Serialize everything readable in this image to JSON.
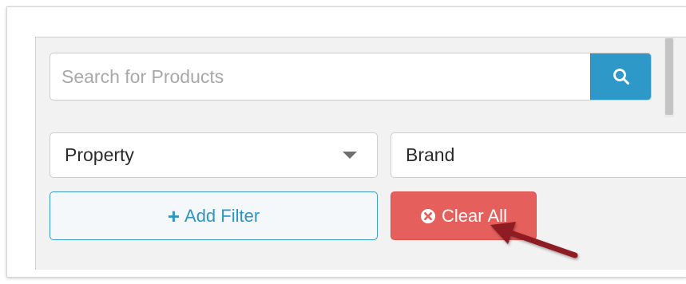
{
  "search": {
    "placeholder": "Search for Products",
    "value": "",
    "button_icon": "search-icon"
  },
  "filters": {
    "property_select": {
      "value": "Property",
      "icon": "chevron-down-icon"
    },
    "brand_select": {
      "value": "Brand"
    }
  },
  "actions": {
    "add_filter": {
      "icon": "plus-icon",
      "label": "Add Filter"
    },
    "clear_all": {
      "icon": "times-circle-icon",
      "label": "Clear All"
    }
  },
  "colors": {
    "primary": "#2e98c9",
    "danger": "#e55f5c",
    "annotation_arrow": "#8e1b23"
  }
}
